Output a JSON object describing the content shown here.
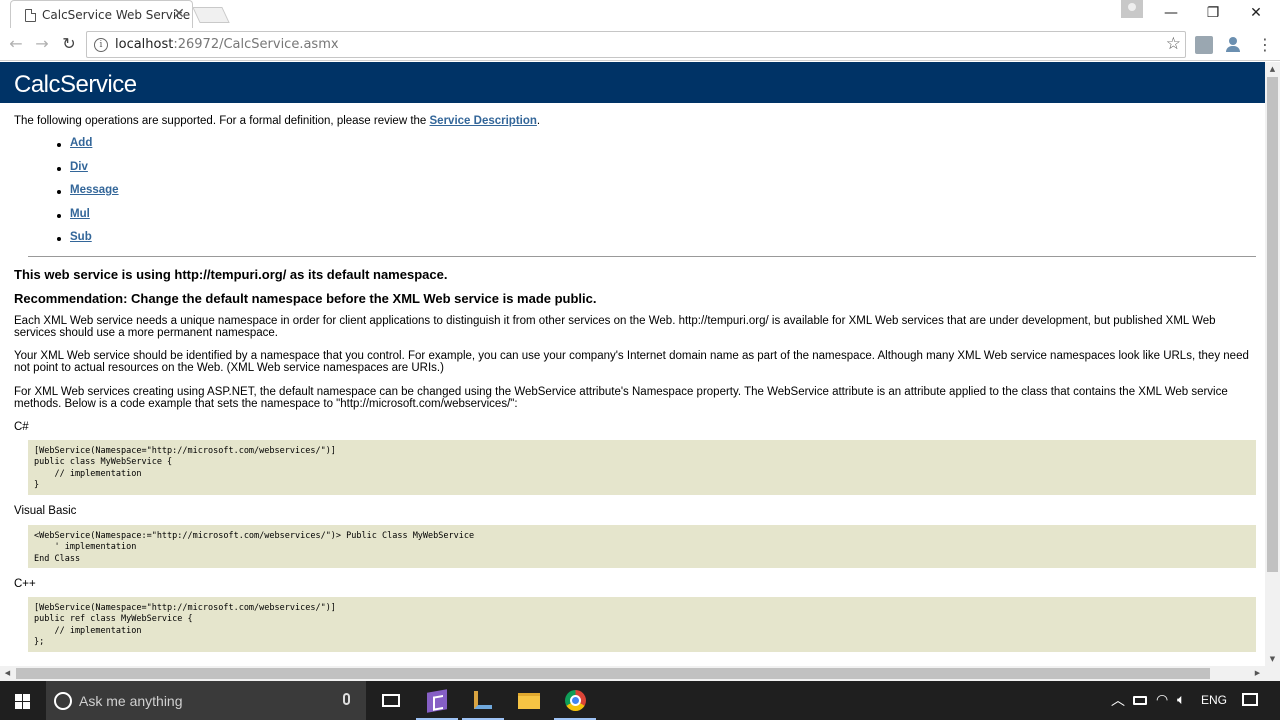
{
  "browser": {
    "tab_title": "CalcService Web Service",
    "tab_close": "✕",
    "url_host": "localhost",
    "url_rest": ":26972/CalcService.asmx",
    "back": "←",
    "forward": "→",
    "reload": "↻",
    "star": "☆",
    "menu": "⋮",
    "info": "i",
    "win_minimize": "—",
    "win_restore": "❐",
    "win_close": "✕"
  },
  "page": {
    "heading": "CalcService",
    "intro_before": "The following operations are supported. For a formal definition, please review the ",
    "intro_link": "Service Description",
    "intro_after": ".",
    "operations": [
      "Add",
      "Div",
      "Message",
      "Mul",
      "Sub"
    ],
    "namespace_line": "This web service is using http://tempuri.org/ as its default namespace.",
    "recommendation": "Recommendation: Change the default namespace before the XML Web service is made public.",
    "para1": "Each XML Web service needs a unique namespace in order for client applications to distinguish it from other services on the Web. http://tempuri.org/ is available for XML Web services that are under development, but published XML Web services should use a more permanent namespace.",
    "para2": "Your XML Web service should be identified by a namespace that you control. For example, you can use your company's Internet domain name as part of the namespace. Although many XML Web service namespaces look like URLs, they need not point to actual resources on the Web. (XML Web service namespaces are URIs.)",
    "para3": "For XML Web services creating using ASP.NET, the default namespace can be changed using the WebService attribute's Namespace property. The WebService attribute is an attribute applied to the class that contains the XML Web service methods. Below is a code example that sets the namespace to \"http://microsoft.com/webservices/\":",
    "csharp_label": "C#",
    "csharp_code": "[WebService(Namespace=\"http://microsoft.com/webservices/\")]\npublic class MyWebService {\n    // implementation\n}",
    "vb_label": "Visual Basic",
    "vb_code": "<WebService(Namespace:=\"http://microsoft.com/webservices/\")> Public Class MyWebService\n    ' implementation\nEnd Class",
    "cpp_label": "C++",
    "cpp_code": "[WebService(Namespace=\"http://microsoft.com/webservices/\")]\npublic ref class MyWebService {\n    // implementation\n};"
  },
  "taskbar": {
    "search_placeholder": "Ask me anything",
    "language": "ENG"
  },
  "colors": {
    "heading_bar": "#003366",
    "link": "#336699",
    "code_bg": "#e5e5cc"
  }
}
